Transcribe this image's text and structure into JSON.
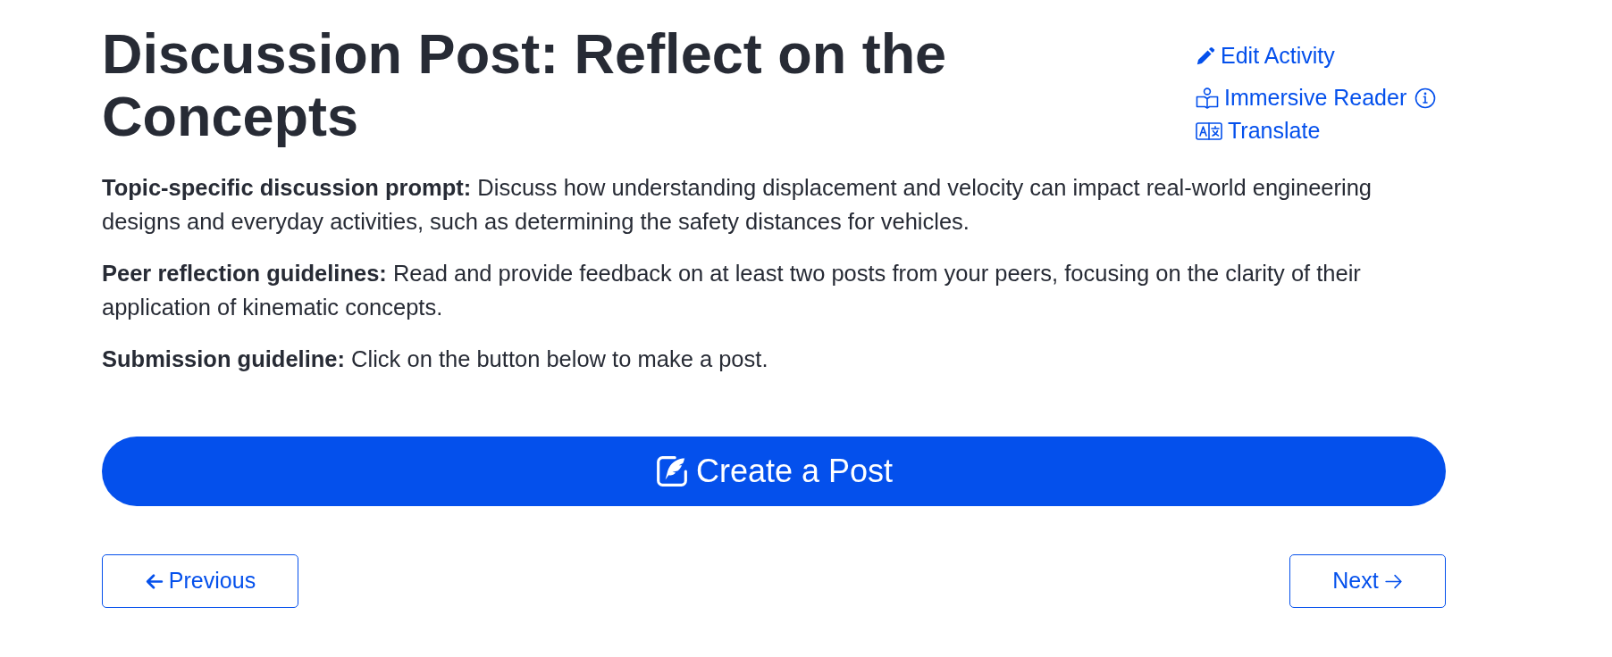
{
  "title": "Discussion Post: Reflect on the Concepts",
  "actions": [
    {
      "kind": "edit",
      "label": "Edit Activity"
    },
    {
      "kind": "reader",
      "label": "Immersive Reader"
    },
    {
      "kind": "translate",
      "label": "Translate"
    }
  ],
  "paragraphs": [
    "**Topic-specific discussion prompt:** Discuss how understanding displacement and velocity can impact real-world engineering designs and everyday activities, such as determining the safety distances for vehicles.",
    "**Peer reflection guidelines:** Read and provide feedback on at least two posts from your peers, focusing on the clarity of their application of kinematic concepts.",
    "**Submission guideline:** Click on the button below to make a post."
  ],
  "create_button": {
    "label": "Create a Post"
  },
  "navigation": [
    {
      "kind": "previous",
      "label": "Previous"
    },
    {
      "kind": "next",
      "label": "Next"
    }
  ]
}
